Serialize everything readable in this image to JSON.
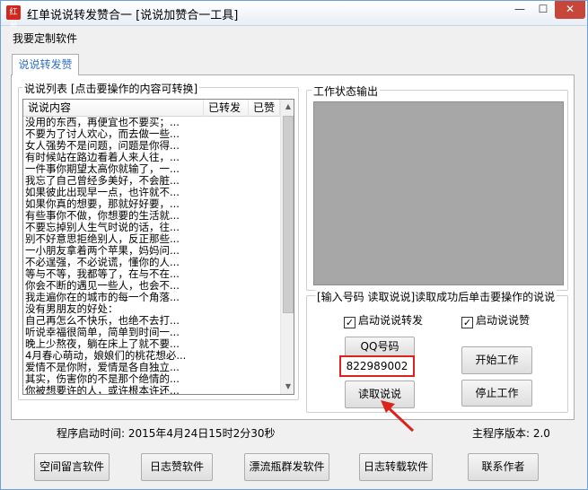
{
  "window": {
    "title": "红单说说转发赞合一   [说说加赞合一工具]",
    "icon_label": "红单",
    "min_glyph": "—",
    "max_glyph": "☐",
    "close_glyph": "✕"
  },
  "menu": {
    "items": [
      "我要定制软件"
    ]
  },
  "tabs": [
    {
      "label": "说说转发赞"
    }
  ],
  "list_group": {
    "title": "说说列表 [点击要操作的内容可转换]",
    "columns": [
      "说说内容",
      "已转发",
      "已赞"
    ],
    "rows": [
      "没用的东西，再便宜也不要买；...",
      "不要为了讨人欢心，而去做一些...",
      "女人强势不是问题，问题是你得...",
      "有时候站在路边看着人来人往，...",
      "一件事你期望太高你就输了，一...",
      "我忘了自己曾经多美好，不会脏...",
      "如果彼此出现早一点，也许就不...",
      "如果你真的想要，那就好好要，...",
      "有些事你不做，你想要的生活就...",
      "不要忘掉别人生气时说的话，往...",
      "别不好意思拒绝别人，反正那些...",
      "一小朋友拿着两个苹果，妈妈问...",
      "不必逞强，不必说谎，懂你的人...",
      "等与不等，我都等了，在与不在...",
      "你会不断的遇见一些人，也会不...",
      "我走遍你在的城市的每一个角落...",
      "没有男朋友的好处：",
      "自己再怎么不快乐，也绝不去打...",
      "听说幸福很简单，简单到时间一...",
      "晚上少熬夜，躺在床上了就不要...",
      "4月春心萌动，娘娘们的桃花想必...",
      "爱情不是你附，爱情是各自独立...",
      "其实，伤害你的不是那个绝情的...",
      "你被想要许的人，或许根本许还..."
    ]
  },
  "status_group": {
    "title": "工作状态输出"
  },
  "input_group": {
    "title": "[输入号码 读取说说]读取成功后单击要操作的说说",
    "checkbox_forward": {
      "label": "启动说说转发",
      "checked": true
    },
    "checkbox_like": {
      "label": "启动说说赞",
      "checked": true
    },
    "qq_label": "QQ号码",
    "qq_value": "822989002",
    "read_button": "读取说说",
    "start_button": "开始工作",
    "stop_button": "停止工作",
    "check_glyph": "✓"
  },
  "footer": {
    "start_time": "程序启动时间: 2015年4月24日15时2分30秒",
    "version": "主程序版本: 2.0",
    "buttons": [
      "空间留言软件",
      "日志赞软件",
      "漂流瓶群发软件",
      "日志转载软件",
      "联系作者"
    ]
  },
  "colors": {
    "accent_red": "#d8241a",
    "tab_text": "#2f6fc6",
    "status_bg": "#a7a7a7"
  }
}
